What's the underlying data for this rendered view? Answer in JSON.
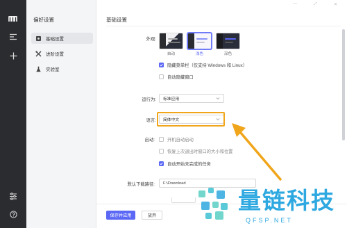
{
  "sidebar": {
    "title": "偏好设置",
    "items": [
      {
        "label": "基础设置"
      },
      {
        "label": "进阶设置"
      },
      {
        "label": "实验室"
      }
    ]
  },
  "main": {
    "title": "基础设置",
    "appearance": {
      "label": "外观:",
      "themes": [
        {
          "label": "自动"
        },
        {
          "label": "浅色"
        },
        {
          "label": "深色"
        }
      ],
      "options": [
        {
          "label": "隐藏菜单栏（仅支持 Windows 和 Linux）",
          "checked": true
        },
        {
          "label": "自动隐藏窗口",
          "checked": false
        }
      ]
    },
    "run_as": {
      "label": "运行为:",
      "value": "标准应用"
    },
    "language": {
      "label": "语言:",
      "value": "简体中文"
    },
    "startup": {
      "label": "启动:",
      "options": [
        {
          "label": "开机自动启动",
          "checked": false
        },
        {
          "label": "恢复上次退出时窗口的大小和位置",
          "checked": false
        },
        {
          "label": "自动开始未完成的任务",
          "checked": true
        }
      ]
    },
    "download_path": {
      "label": "默认下载路径:",
      "value": "F:\\Download"
    }
  },
  "footer": {
    "save_label": "保存并应用",
    "cancel_label": "放弃"
  },
  "watermark": {
    "text": "量链科技",
    "sub": "QFSP.NET"
  },
  "colors": {
    "accent": "#5b67f5",
    "highlight": "#f0a51a",
    "rail": "#2b2c30",
    "watermark": "#2ea8e0"
  }
}
